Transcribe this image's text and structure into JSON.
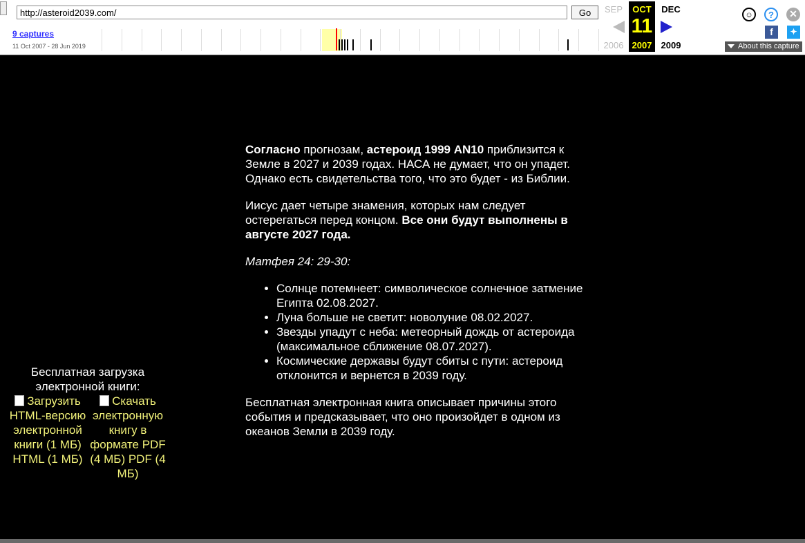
{
  "toolbar": {
    "url": "http://asteroid2039.com/",
    "go_label": "Go",
    "captures_link": "9 captures",
    "captures_range": "11 Oct 2007 - 28 Jun 2019",
    "prev_month": "SEP",
    "prev_year": "2006",
    "cur_month": "OCT",
    "cur_day": "11",
    "cur_year": "2007",
    "next_month": "DEC",
    "next_year": "2009",
    "about_capture": "About this capture",
    "icons": [
      "user-icon",
      "help-icon",
      "close-icon",
      "facebook-icon",
      "twitter-icon",
      "back-arrow-icon",
      "forward-arrow-icon"
    ]
  },
  "article": {
    "p1_b1": "Согласно",
    "p1_t1": " прогнозам, ",
    "p1_b2": "астероид 1999 AN10",
    "p1_t2": " приблизится к Земле в 2027 и 2039 годах. НАСА не думает, что он упадет. Однако есть свидетельства того, что это будет - из Библии.",
    "p2_t1": "Иисус дает четыре знамения, которых нам следует остерегаться перед концом. ",
    "p2_b1": "Все они будут выполнены в августе 2027 года.",
    "ref": "Матфея 24: 29-30:",
    "signs": [
      "Солнце потемнеет: символическое солнечное затмение Египта 02.08.2027.",
      "Луна больше не светит: новолуние 08.02.2027.",
      "Звезды упадут с неба: метеорный дождь от астероида (максимальное сближение 08.07.2027).",
      "Космические державы будут сбиты с пути: астероид отклонится и вернется в 2039 году."
    ],
    "p3": "Бесплатная электронная книга описывает причины этого события и предсказывает, что оно произойдет в одном из океанов Земли в 2039 году."
  },
  "sidebar": {
    "ebook_title": "Бесплатная загрузка электронной книги:",
    "html_download": "Загрузить HTML-версию электронной книги (1 МБ) HTML (1 МБ)",
    "pdf_download": "Скачать электронную книгу в формате PDF (4 МБ) PDF (4 МБ)"
  },
  "colors": {
    "background": "#000000",
    "text": "#ffffff",
    "link": "#f2f27a",
    "wayback_highlight": "#ffff00"
  }
}
